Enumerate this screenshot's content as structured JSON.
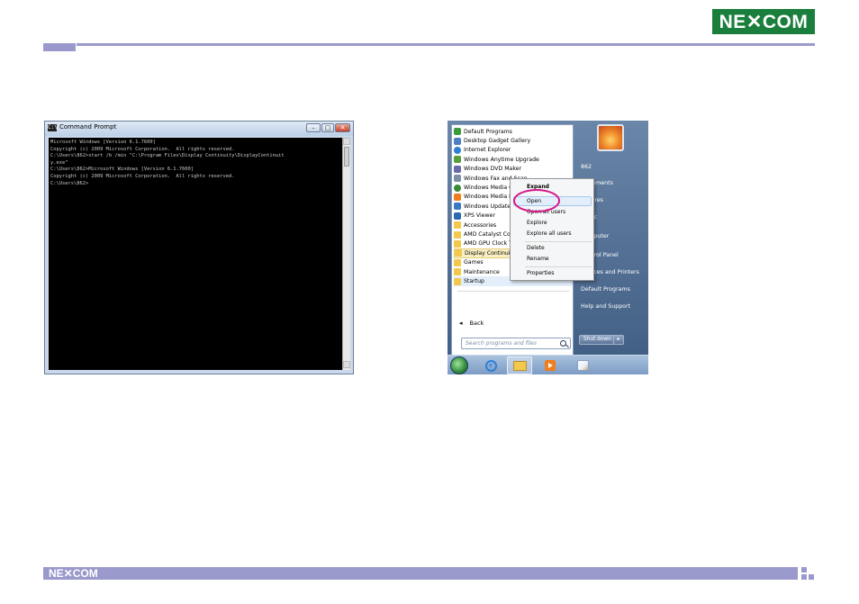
{
  "brand": {
    "logo_text": "NE✕COM",
    "footer_logo_text": "NE✕COM"
  },
  "cmd": {
    "title": "Command Prompt",
    "icon_label": "C:\\",
    "lines": [
      "Microsoft Windows [Version 6.1.7600]",
      "Copyright (c) 2009 Microsoft Corporation.  All rights reserved.",
      "",
      "C:\\Users\\862>start /b /min \"C:\\Program Files\\Display Continuity\\DisplayContinuit",
      "y.exe\"",
      "",
      "C:\\Users\\862>Microsoft Windows [Version 6.1.7600]",
      "Copyright (c) 2009 Microsoft Corporation.  All rights reserved.",
      "",
      "C:\\Users\\862>"
    ],
    "buttons": {
      "minimize": "–",
      "maximize": "□",
      "close": "✕"
    }
  },
  "start_menu": {
    "programs": [
      {
        "label": "Default Programs",
        "color": "#3a9b3a"
      },
      {
        "label": "Desktop Gadget Gallery",
        "color": "#4d7fc4"
      },
      {
        "label": "Internet Explorer",
        "color": "#2d7fd6"
      },
      {
        "label": "Windows Anytime Upgrade",
        "color": "#5a9e3a"
      },
      {
        "label": "Windows DVD Maker",
        "color": "#6a6aa8"
      },
      {
        "label": "Windows Fax and Scan",
        "color": "#7d8ea6"
      },
      {
        "label": "Windows Media Center",
        "color": "#3a8a3a"
      },
      {
        "label": "Windows Media Player",
        "color": "#f07c1c"
      },
      {
        "label": "Windows Update",
        "color": "#3a77c4"
      },
      {
        "label": "XPS Viewer",
        "color": "#2a6ab0"
      },
      {
        "label": "Accessories",
        "color": "folder"
      },
      {
        "label": "AMD Catalyst Control Center",
        "color": "folder"
      },
      {
        "label": "AMD GPU Clock Tool",
        "color": "folder"
      },
      {
        "label": "Display Continuity",
        "color": "folder",
        "selected": true
      },
      {
        "label": "Games",
        "color": "folder"
      },
      {
        "label": "Maintenance",
        "color": "folder"
      },
      {
        "label": "Startup",
        "color": "folder",
        "hover": true
      }
    ],
    "back_label": "Back",
    "search_placeholder": "Search programs and files",
    "right_items": [
      "862",
      "Documents",
      "Pictures",
      "Music",
      "Computer",
      "Control Panel",
      "Devices and Printers",
      "Default Programs",
      "Help and Support"
    ],
    "shutdown_label": "Shut down",
    "shutdown_arrow": "▸"
  },
  "context_menu": {
    "items": [
      "Expand",
      "Open",
      "Open all users",
      "Explore",
      "Explore all users",
      "Delete",
      "Rename",
      "Properties"
    ]
  },
  "taskbar": {
    "buttons": [
      "windows-orb",
      "internet-explorer",
      "windows-explorer",
      "windows-media-player",
      "paint"
    ]
  },
  "colors": {
    "brand_green": "#1a7f3c",
    "accent_lavender": "#9999cc",
    "highlight_ring": "#d6168a"
  }
}
